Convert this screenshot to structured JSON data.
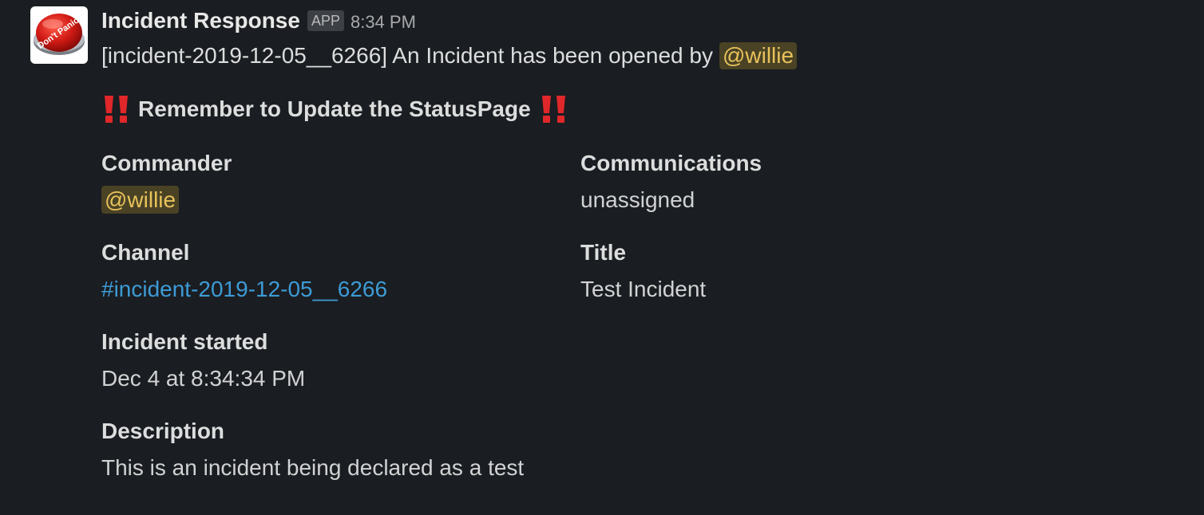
{
  "message": {
    "sender": "Incident Response",
    "badge": "APP",
    "time": "8:34 PM",
    "avatar_icon": "dont-panic-button-icon",
    "avatar_text": "Don't Panic!",
    "intro_text": "[incident-2019-12-05__6266] An Incident has been opened by",
    "intro_mention": "@willie",
    "reminder_emoji": "bangbang-icon",
    "reminder_text": "Remember to Update the StatusPage"
  },
  "fields": {
    "commander": {
      "label": "Commander",
      "value": "@willie"
    },
    "communications": {
      "label": "Communications",
      "value": "unassigned"
    },
    "channel": {
      "label": "Channel",
      "value": "#incident-2019-12-05__6266"
    },
    "title": {
      "label": "Title",
      "value": "Test Incident"
    },
    "started": {
      "label": "Incident started",
      "value": "Dec 4 at 8:34:34 PM"
    },
    "description": {
      "label": "Description",
      "value": "This is an incident being declared as a test"
    }
  },
  "colors": {
    "background": "#1a1d21",
    "mention_bg": "#4a4225",
    "mention_text": "#e8c25a",
    "link": "#3d9bd6",
    "bangbang": "#e0272a"
  }
}
